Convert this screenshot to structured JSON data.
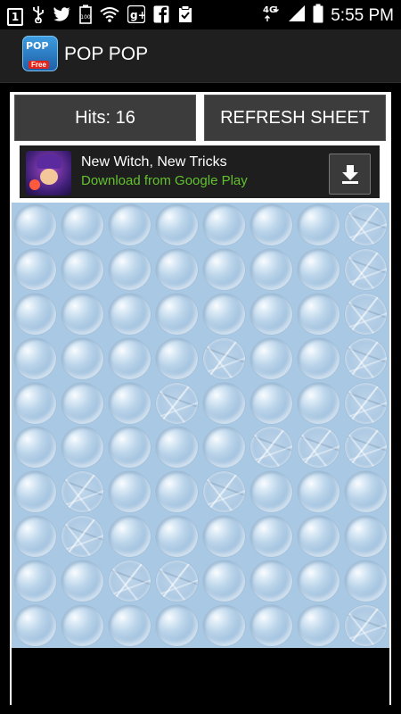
{
  "status_bar": {
    "notification_count": "1",
    "network_type": "4G",
    "time": "5:55 PM",
    "left_icons": [
      "notification-count-icon",
      "usb-icon",
      "twitter-icon",
      "battery-100-icon",
      "wifi-icon",
      "google-plus-icon",
      "facebook-icon",
      "clipboard-check-icon"
    ],
    "right_icons": [
      "network-4g-icon",
      "signal-icon",
      "battery-icon"
    ]
  },
  "app_bar": {
    "title": "POP POP",
    "icon_name": "pop-pop-app-icon"
  },
  "controls": {
    "hits_label": "Hits: 16",
    "refresh_label": "REFRESH SHEET"
  },
  "ad": {
    "title": "New Witch, New Tricks",
    "subtitle": "Download from Google Play",
    "thumbnail": "game-thumbnail-icon",
    "download_icon": "download-icon"
  },
  "sheet": {
    "rows": 10,
    "cols": 8,
    "popped": [
      [
        0,
        7
      ],
      [
        1,
        7
      ],
      [
        2,
        7
      ],
      [
        3,
        4
      ],
      [
        3,
        7
      ],
      [
        4,
        3
      ],
      [
        4,
        7
      ],
      [
        5,
        5
      ],
      [
        5,
        6
      ],
      [
        5,
        7
      ],
      [
        6,
        1
      ],
      [
        6,
        4
      ],
      [
        7,
        1
      ],
      [
        8,
        2
      ],
      [
        8,
        3
      ],
      [
        9,
        7
      ]
    ]
  },
  "colors": {
    "status_bar": "#000000",
    "action_bar": "#1f1f1f",
    "button": "#3c3c3c",
    "ad_subtitle": "#62c22d",
    "sheet_background": "#a9c8e3"
  }
}
